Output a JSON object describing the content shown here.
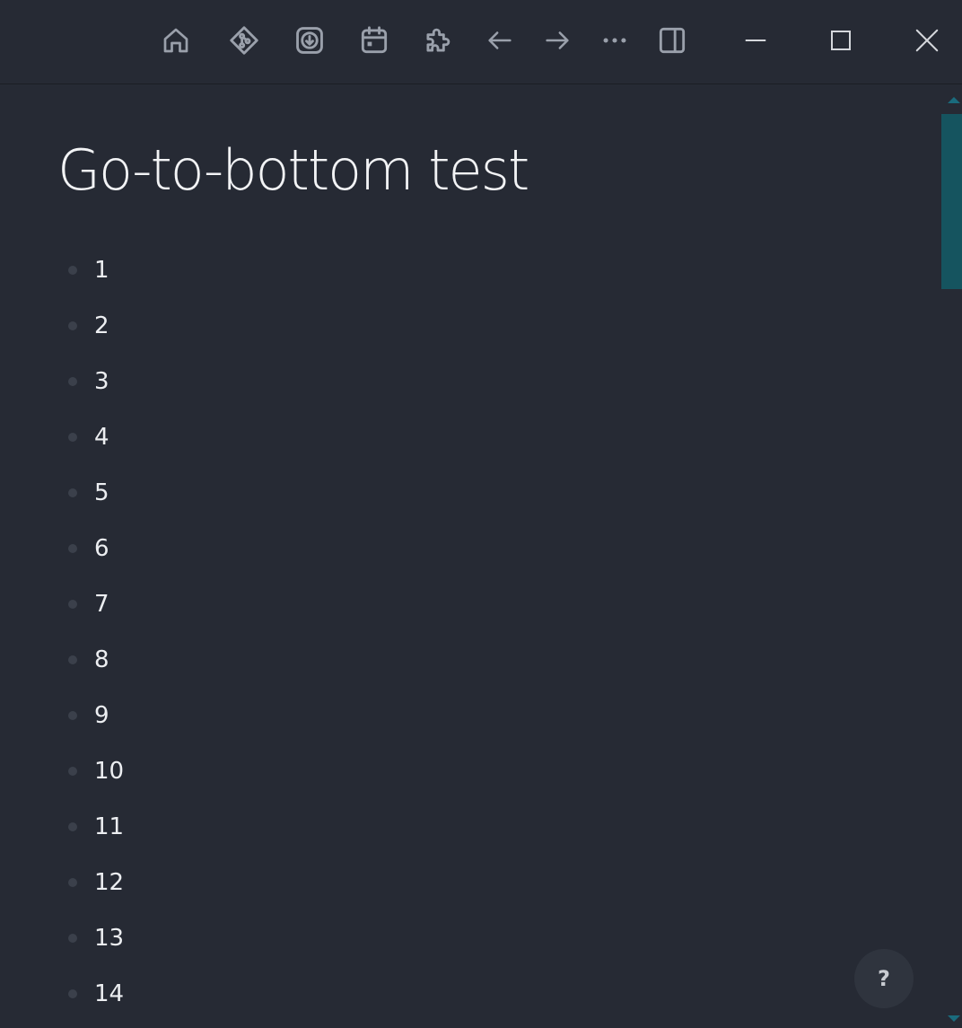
{
  "toolbar": {
    "icons": [
      "home-icon",
      "git-icon",
      "download-icon",
      "calendar-icon",
      "extensions-icon",
      "back-arrow-icon",
      "forward-arrow-icon",
      "more-icon",
      "sidebar-toggle-icon"
    ],
    "window_controls": [
      "minimize-icon",
      "maximize-icon",
      "close-icon"
    ]
  },
  "page": {
    "title": "Go-to-bottom test",
    "blocks": [
      "1",
      "2",
      "3",
      "4",
      "5",
      "6",
      "7",
      "8",
      "9",
      "10",
      "11",
      "12",
      "13",
      "14"
    ]
  },
  "help": {
    "label": "?"
  },
  "colors": {
    "background": "#262a34",
    "accent_scrollbar": "#15545f",
    "text": "#eceef1",
    "icon": "#9aa0ab"
  }
}
